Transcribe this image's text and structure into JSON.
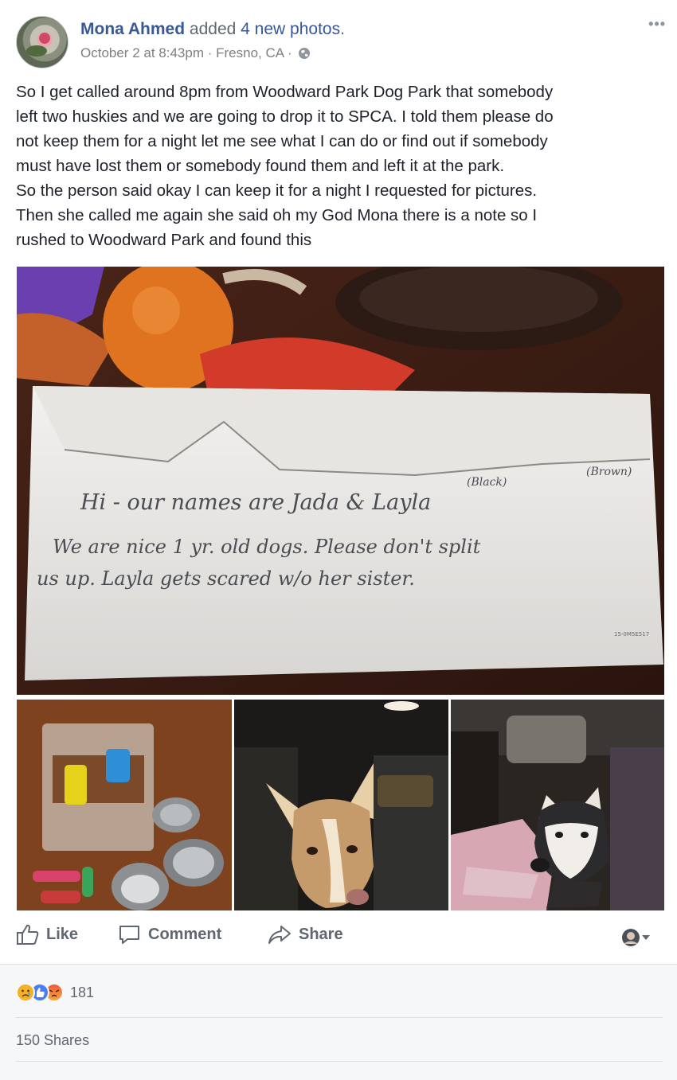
{
  "post": {
    "author": "Mona Ahmed",
    "action_prefix": "added",
    "action_count": "4 new photos",
    "action_suffix": ".",
    "timestamp": "October 2 at 8:43pm",
    "separator": "·",
    "location": "Fresno, CA",
    "privacy_icon": "globe-icon",
    "more_label": "•••",
    "text_lines": [
      "So I get called around 8pm from Woodward Park Dog Park that somebody",
      "left two huskies and we are going to drop it to SPCA. I told them please do",
      "not keep them for a night let me see what I can do or find out if somebody",
      "must have lost them or somebody found them and left it at the park.",
      "So the person said okay I can keep it for a night I requested for pictures.",
      "Then she called me again she said oh my God Mona there is a note so I",
      "rushed to Woodward Park and found this"
    ]
  },
  "note": {
    "line1": "Hi - our names are Jada & Layla",
    "label_black": "(Black)",
    "label_brown": "(Brown)",
    "line2": "We are nice 1 yr. old dogs. Please don't split",
    "line3": "us up. Layla gets scared w/o her sister.",
    "stamp": "15-0M5E517"
  },
  "actions": {
    "like": "Like",
    "comment": "Comment",
    "share": "Share"
  },
  "footer": {
    "reaction_icons": [
      "sad-reaction-icon",
      "like-reaction-icon",
      "angry-reaction-icon"
    ],
    "reaction_count": "181",
    "shares": "150 Shares"
  },
  "colors": {
    "author_link": "#385898",
    "meta_text": "#606770",
    "divider": "#dddfe2",
    "footer_bg": "#f6f7f9"
  }
}
